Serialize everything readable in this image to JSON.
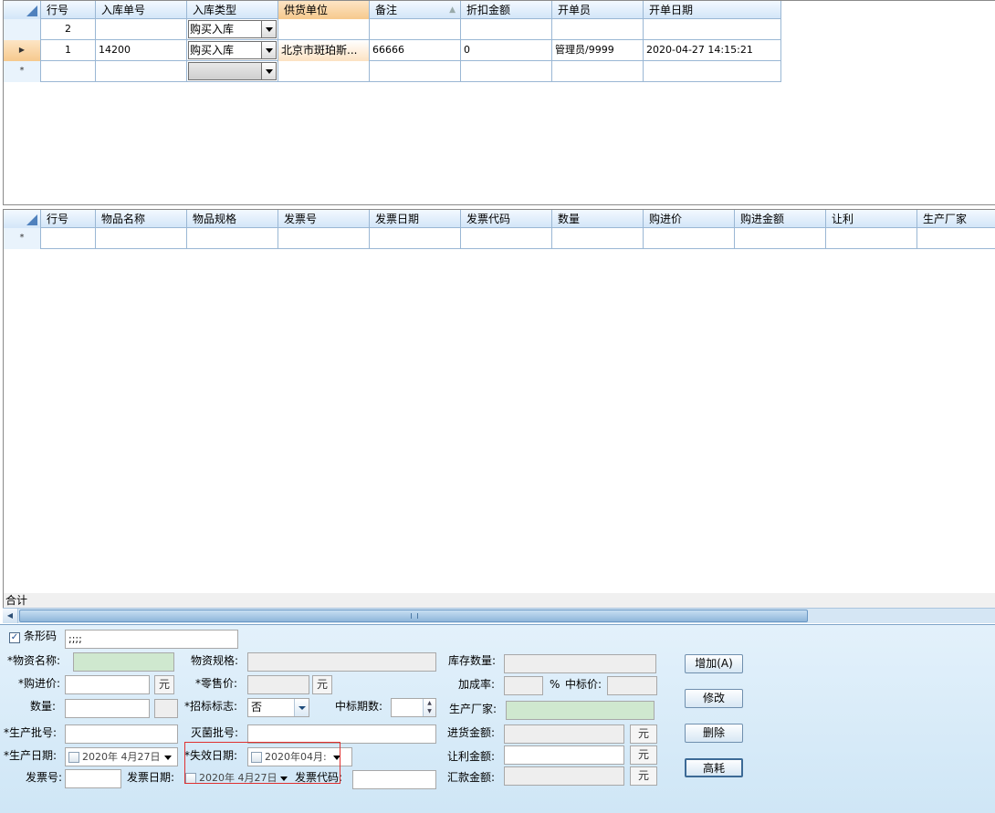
{
  "top_grid": {
    "headers": [
      "行号",
      "入库单号",
      "入库类型",
      "供货单位",
      "备注",
      "折扣金额",
      "开单员",
      "开单日期"
    ],
    "rows": [
      {
        "row_no": "2",
        "doc_no": "",
        "type": "购买入库",
        "supplier": "",
        "remark": "",
        "discount": "",
        "clerk": "",
        "date": ""
      },
      {
        "row_no": "1",
        "doc_no": "14200",
        "type": "购买入库",
        "supplier": "北京市斑珀斯...",
        "remark": "66666",
        "discount": "0",
        "clerk": "管理员/9999",
        "date": "2020-04-27 14:15:21"
      }
    ],
    "new_row_marker": "*",
    "current_row_marker": "▶"
  },
  "bottom_grid": {
    "headers": [
      "行号",
      "物品名称",
      "物品规格",
      "发票号",
      "发票日期",
      "发票代码",
      "数量",
      "购进价",
      "购进金额",
      "让利",
      "生产厂家"
    ],
    "new_row_marker": "*"
  },
  "total_label": "合计",
  "form": {
    "barcode_label": "条形码",
    "barcode_value": ";;;;",
    "barcode_checked": "✓",
    "material_name_label": "*物资名称:",
    "spec_label": "物资规格:",
    "stock_label": "库存数量:",
    "purchase_price_label": "*购进价:",
    "retail_price_label": "*零售价:",
    "markup_label": "加成率:",
    "percent": "%",
    "bid_price_label": "中标价:",
    "quantity_label": "数量:",
    "tender_flag_label": "*招标标志:",
    "tender_flag_value": "否",
    "bid_periods_label": "中标期数:",
    "manufacturer_label": "生产厂家:",
    "batch_label": "*生产批号:",
    "sterile_batch_label": "灭菌批号:",
    "purchase_amount_label": "进货金额:",
    "prod_date_label": "*生产日期:",
    "prod_date_value": "2020年  4月27日",
    "expiry_date_label": "*失效日期:",
    "expiry_date_value": "2020年04月:",
    "discount_amount_label": "让利金额:",
    "invoice_no_label": "发票号:",
    "invoice_date_label": "发票日期:",
    "invoice_date_value": "2020年  4月27日",
    "invoice_code_label": "发票代码:",
    "remit_amount_label": "汇款金额:",
    "yuan": "元",
    "btn_add": "增加(A)",
    "btn_edit": "修改",
    "btn_delete": "删除",
    "btn_high": "高耗"
  }
}
